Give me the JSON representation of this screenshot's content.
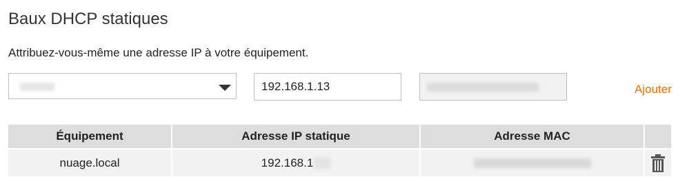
{
  "section": {
    "title": "Baux DHCP statiques",
    "subtitle": "Attribuez-vous-même une adresse IP à votre équipement."
  },
  "form": {
    "device_select": {
      "selected_value": "PC-XX",
      "obscured": true
    },
    "ip_field": {
      "value": "192.168.1.13"
    },
    "mac_field": {
      "value": "00:61:C7:08:89:E5",
      "obscured": true
    },
    "add_label": "Ajouter"
  },
  "table": {
    "headers": [
      "Équipement",
      "Adresse IP statique",
      "Adresse MAC",
      ""
    ],
    "rows": [
      {
        "device": "nuage.local",
        "ip_visible": "192.168.1",
        "mac": "00:1C:23:B5:D8:96",
        "mac_obscured": true
      }
    ]
  },
  "colors": {
    "accent": "#f16e00",
    "header_bg": "#dddddd",
    "row_bg": "#f2f2f2",
    "border": "#bdbdbd"
  },
  "icons": {
    "dropdown": "chevron-down-icon",
    "delete": "trash-icon"
  }
}
